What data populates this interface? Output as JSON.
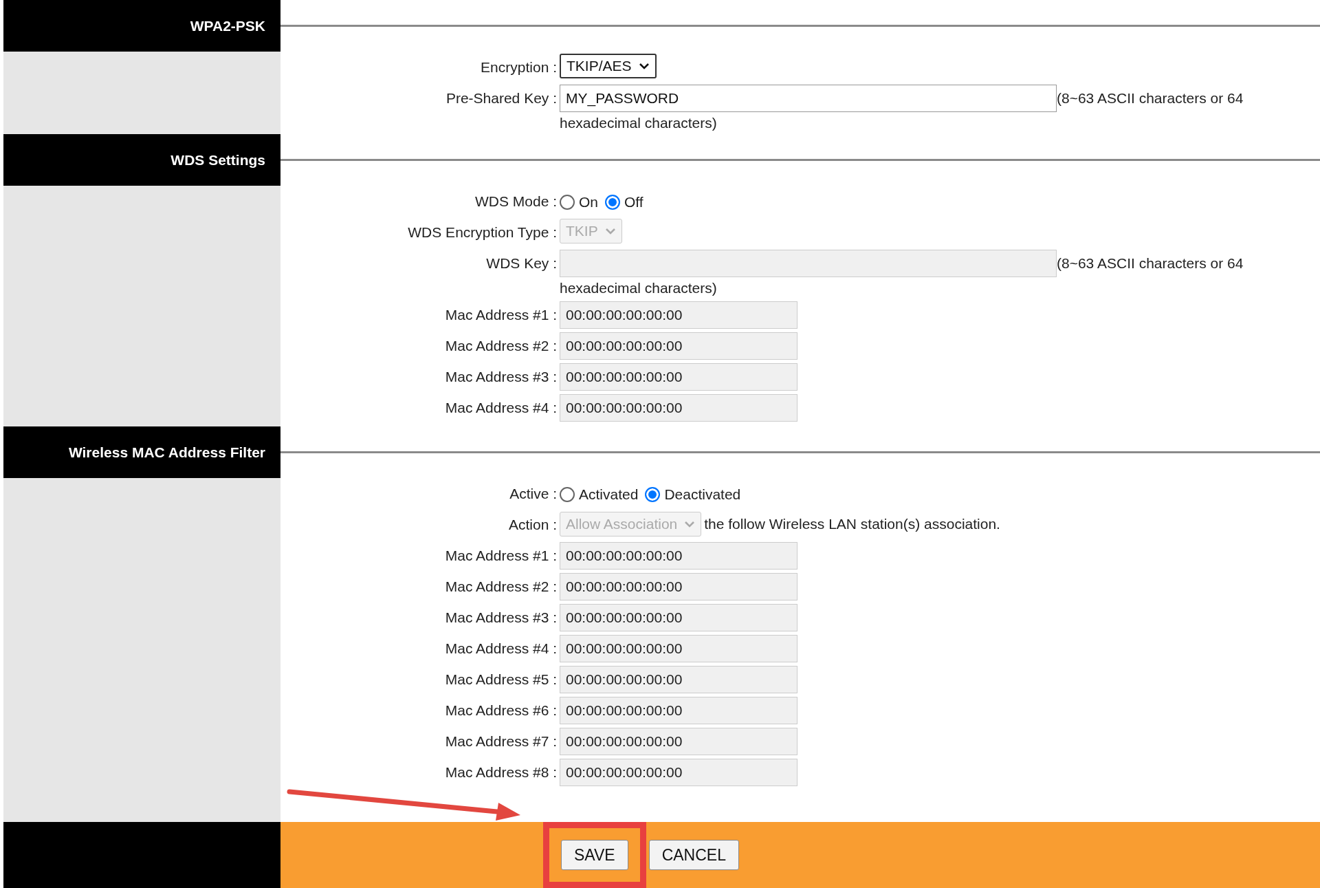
{
  "sections": [
    {
      "title": "WPA2-PSK",
      "rows": [
        {
          "kind": "select",
          "label": "Encryption :",
          "value": "TKIP/AES",
          "disabled": false
        },
        {
          "kind": "text",
          "label": "Pre-Shared Key :",
          "value": "MY_PASSWORD",
          "disabled": false,
          "hint": [
            "(8~63 ASCII characters or 64",
            "hexadecimal characters)"
          ]
        }
      ]
    },
    {
      "title": "WDS Settings",
      "rows": [
        {
          "kind": "radio",
          "label": "WDS Mode :",
          "options": [
            {
              "label": "On",
              "selected": false
            },
            {
              "label": "Off",
              "selected": true
            }
          ]
        },
        {
          "kind": "select",
          "label": "WDS Encryption Type :",
          "value": "TKIP",
          "disabled": true
        },
        {
          "kind": "text",
          "label": "WDS Key :",
          "disabled": true,
          "hint": [
            "(8~63 ASCII characters or 64",
            "hexadecimal characters)"
          ]
        },
        {
          "kind": "mac",
          "label": "Mac Address #1 :",
          "value": "00:00:00:00:00:00",
          "disabled": true
        },
        {
          "kind": "mac",
          "label": "Mac Address #2 :",
          "value": "00:00:00:00:00:00",
          "disabled": true
        },
        {
          "kind": "mac",
          "label": "Mac Address #3 :",
          "value": "00:00:00:00:00:00",
          "disabled": true
        },
        {
          "kind": "mac",
          "label": "Mac Address #4 :",
          "value": "00:00:00:00:00:00",
          "disabled": true
        }
      ]
    },
    {
      "title": "Wireless MAC Address Filter",
      "rows": [
        {
          "kind": "radio",
          "label": "Active :",
          "options": [
            {
              "label": "Activated",
              "selected": false
            },
            {
              "label": "Deactivated",
              "selected": true
            }
          ]
        },
        {
          "kind": "select",
          "label": "Action :",
          "value": "Allow Association",
          "disabled": true,
          "suffix": "the follow Wireless LAN station(s) association."
        },
        {
          "kind": "mac",
          "label": "Mac Address #1 :",
          "value": "00:00:00:00:00:00",
          "disabled": true
        },
        {
          "kind": "mac",
          "label": "Mac Address #2 :",
          "value": "00:00:00:00:00:00",
          "disabled": true
        },
        {
          "kind": "mac",
          "label": "Mac Address #3 :",
          "value": "00:00:00:00:00:00",
          "disabled": true
        },
        {
          "kind": "mac",
          "label": "Mac Address #4 :",
          "value": "00:00:00:00:00:00",
          "disabled": true
        },
        {
          "kind": "mac",
          "label": "Mac Address #5 :",
          "value": "00:00:00:00:00:00",
          "disabled": true
        },
        {
          "kind": "mac",
          "label": "Mac Address #6 :",
          "value": "00:00:00:00:00:00",
          "disabled": true
        },
        {
          "kind": "mac",
          "label": "Mac Address #7 :",
          "value": "00:00:00:00:00:00",
          "disabled": true
        },
        {
          "kind": "mac",
          "label": "Mac Address #8 :",
          "value": "00:00:00:00:00:00",
          "disabled": true
        }
      ]
    }
  ],
  "buttons": [
    {
      "label": "SAVE",
      "highlighted": true
    },
    {
      "label": "CANCEL",
      "highlighted": false
    }
  ]
}
